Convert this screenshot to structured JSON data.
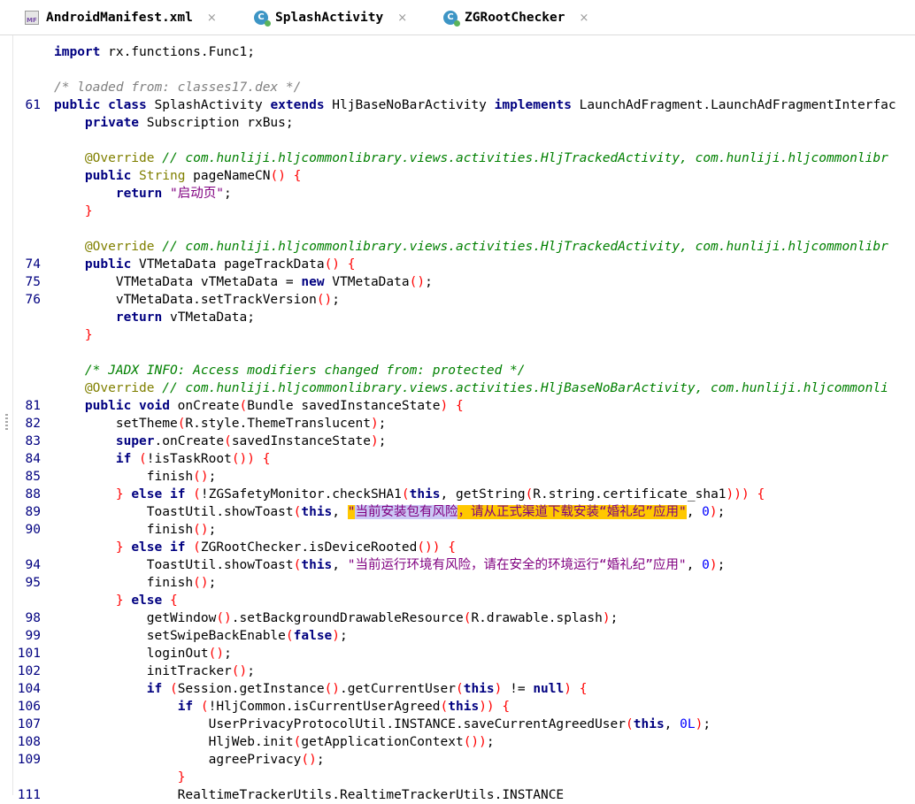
{
  "tabs": [
    {
      "label": "AndroidManifest.xml",
      "icon": "manifest-file-icon",
      "close": "×"
    },
    {
      "label": "SplashActivity",
      "icon": "class-file-icon",
      "close": "×"
    },
    {
      "label": "ZGRootChecker",
      "icon": "class-file-icon",
      "close": "×"
    }
  ],
  "editor": {
    "lines": [
      {
        "n": "",
        "t": [
          [
            "",
            ""
          ]
        ]
      },
      {
        "n": "",
        "t": [
          [
            "kw",
            "import"
          ],
          [
            "",
            " rx.functions.Func1;"
          ]
        ]
      },
      {
        "n": "",
        "t": [
          [
            "",
            ""
          ]
        ]
      },
      {
        "n": "",
        "t": [
          [
            "cm",
            "/* loaded from: classes17.dex */"
          ]
        ]
      },
      {
        "n": "61",
        "t": [
          [
            "kw",
            "public class"
          ],
          [
            "",
            " SplashActivity "
          ],
          [
            "kw",
            "extends"
          ],
          [
            "",
            " HljBaseNoBarActivity "
          ],
          [
            "kw",
            "implements"
          ],
          [
            "",
            " LaunchAdFragment.LaunchAdFragmentInterfac"
          ]
        ]
      },
      {
        "n": "",
        "t": [
          [
            "",
            "    "
          ],
          [
            "kw",
            "private"
          ],
          [
            "",
            " Subscription rxBus;"
          ]
        ]
      },
      {
        "n": "",
        "t": [
          [
            "",
            ""
          ]
        ]
      },
      {
        "n": "",
        "t": [
          [
            "",
            "    "
          ],
          [
            "ann",
            "@Override"
          ],
          [
            "",
            " "
          ],
          [
            "cmg",
            "// com.hunliji.hljcommonlibrary.views.activities.HljTrackedActivity, com.hunliji.hljcommonlibr"
          ]
        ]
      },
      {
        "n": "",
        "t": [
          [
            "",
            "    "
          ],
          [
            "kw",
            "public"
          ],
          [
            "",
            " "
          ],
          [
            "typ",
            "String"
          ],
          [
            "",
            " pageNameCN"
          ],
          [
            "par",
            "()"
          ],
          [
            "",
            " "
          ],
          [
            "par",
            "{"
          ]
        ]
      },
      {
        "n": "",
        "t": [
          [
            "",
            "        "
          ],
          [
            "kw",
            "return"
          ],
          [
            "",
            " "
          ],
          [
            "strp",
            "\"启动页\""
          ],
          [
            "",
            ";"
          ]
        ]
      },
      {
        "n": "",
        "t": [
          [
            "",
            "    "
          ],
          [
            "par",
            "}"
          ]
        ]
      },
      {
        "n": "",
        "t": [
          [
            "",
            ""
          ]
        ]
      },
      {
        "n": "",
        "t": [
          [
            "",
            "    "
          ],
          [
            "ann",
            "@Override"
          ],
          [
            "",
            " "
          ],
          [
            "cmg",
            "// com.hunliji.hljcommonlibrary.views.activities.HljTrackedActivity, com.hunliji.hljcommonlibr"
          ]
        ]
      },
      {
        "n": "74",
        "t": [
          [
            "",
            "    "
          ],
          [
            "kw",
            "public"
          ],
          [
            "",
            " VTMetaData pageTrackData"
          ],
          [
            "par",
            "()"
          ],
          [
            "",
            " "
          ],
          [
            "par",
            "{"
          ]
        ]
      },
      {
        "n": "75",
        "t": [
          [
            "",
            "        VTMetaData vTMetaData = "
          ],
          [
            "kw",
            "new"
          ],
          [
            "",
            " VTMetaData"
          ],
          [
            "par",
            "()"
          ],
          [
            "",
            ";"
          ]
        ]
      },
      {
        "n": "76",
        "t": [
          [
            "",
            "        vTMetaData.setTrackVersion"
          ],
          [
            "par",
            "()"
          ],
          [
            "",
            ";"
          ]
        ]
      },
      {
        "n": "",
        "t": [
          [
            "",
            "        "
          ],
          [
            "kw",
            "return"
          ],
          [
            "",
            " vTMetaData;"
          ]
        ]
      },
      {
        "n": "",
        "t": [
          [
            "",
            "    "
          ],
          [
            "par",
            "}"
          ]
        ]
      },
      {
        "n": "",
        "t": [
          [
            "",
            ""
          ]
        ]
      },
      {
        "n": "",
        "t": [
          [
            "",
            "    "
          ],
          [
            "cmg",
            "/* JADX INFO: Access modifiers changed from: protected */"
          ]
        ]
      },
      {
        "n": "",
        "t": [
          [
            "",
            "    "
          ],
          [
            "ann",
            "@Override"
          ],
          [
            "",
            " "
          ],
          [
            "cmg",
            "// com.hunliji.hljcommonlibrary.views.activities.HljBaseNoBarActivity, com.hunliji.hljcommonli"
          ]
        ]
      },
      {
        "n": "81",
        "t": [
          [
            "",
            "    "
          ],
          [
            "kw",
            "public void"
          ],
          [
            "",
            " onCreate"
          ],
          [
            "par",
            "("
          ],
          [
            "",
            "Bundle savedInstanceState"
          ],
          [
            "par",
            ")"
          ],
          [
            "",
            " "
          ],
          [
            "par",
            "{"
          ]
        ]
      },
      {
        "n": "82",
        "t": [
          [
            "",
            "        setTheme"
          ],
          [
            "par",
            "("
          ],
          [
            "",
            "R.style.ThemeTranslucent"
          ],
          [
            "par",
            ")"
          ],
          [
            "",
            ";"
          ]
        ]
      },
      {
        "n": "83",
        "t": [
          [
            "",
            "        "
          ],
          [
            "kw",
            "super"
          ],
          [
            "",
            ".onCreate"
          ],
          [
            "par",
            "("
          ],
          [
            "",
            "savedInstanceState"
          ],
          [
            "par",
            ")"
          ],
          [
            "",
            ";"
          ]
        ]
      },
      {
        "n": "84",
        "t": [
          [
            "",
            "        "
          ],
          [
            "kw",
            "if"
          ],
          [
            "",
            " "
          ],
          [
            "par",
            "("
          ],
          [
            "",
            "!isTaskRoot"
          ],
          [
            "par",
            "())"
          ],
          [
            "",
            " "
          ],
          [
            "par",
            "{"
          ]
        ]
      },
      {
        "n": "85",
        "t": [
          [
            "",
            "            finish"
          ],
          [
            "par",
            "()"
          ],
          [
            "",
            ";"
          ]
        ]
      },
      {
        "n": "88",
        "t": [
          [
            "",
            "        "
          ],
          [
            "par",
            "}"
          ],
          [
            "",
            " "
          ],
          [
            "kw",
            "else if"
          ],
          [
            "",
            " "
          ],
          [
            "par",
            "("
          ],
          [
            "",
            "!ZGSafetyMonitor.checkSHA1"
          ],
          [
            "par",
            "("
          ],
          [
            "kw",
            "this"
          ],
          [
            "",
            ", getString"
          ],
          [
            "par",
            "("
          ],
          [
            "",
            "R.string.certificate_sha1"
          ],
          [
            "par",
            ")))"
          ],
          [
            "",
            " "
          ],
          [
            "par",
            "{"
          ]
        ]
      },
      {
        "n": "89",
        "t": [
          [
            "",
            "            ToastUtil.showToast"
          ],
          [
            "par",
            "("
          ],
          [
            "kw",
            "this"
          ],
          [
            "",
            ", "
          ],
          [
            "strp hl2",
            "\""
          ],
          [
            "strp hl1",
            "当前安装包有风险"
          ],
          [
            "strp hl2",
            "，请从正式渠道下载安装“婚礼纪”应用\""
          ],
          [
            "",
            ", "
          ],
          [
            "num",
            "0"
          ],
          [
            "par",
            ")"
          ],
          [
            "",
            ";"
          ]
        ]
      },
      {
        "n": "90",
        "t": [
          [
            "",
            "            finish"
          ],
          [
            "par",
            "()"
          ],
          [
            "",
            ";"
          ]
        ]
      },
      {
        "n": "",
        "t": [
          [
            "",
            "        "
          ],
          [
            "par",
            "}"
          ],
          [
            "",
            " "
          ],
          [
            "kw",
            "else if"
          ],
          [
            "",
            " "
          ],
          [
            "par",
            "("
          ],
          [
            "",
            "ZGRootChecker.isDeviceRooted"
          ],
          [
            "par",
            "())"
          ],
          [
            "",
            " "
          ],
          [
            "par",
            "{"
          ]
        ]
      },
      {
        "n": "94",
        "t": [
          [
            "",
            "            ToastUtil.showToast"
          ],
          [
            "par",
            "("
          ],
          [
            "kw",
            "this"
          ],
          [
            "",
            ", "
          ],
          [
            "strp",
            "\"当前运行环境有风险，请在安全的环境运行“婚礼纪”应用\""
          ],
          [
            "",
            ", "
          ],
          [
            "num",
            "0"
          ],
          [
            "par",
            ")"
          ],
          [
            "",
            ";"
          ]
        ]
      },
      {
        "n": "95",
        "t": [
          [
            "",
            "            finish"
          ],
          [
            "par",
            "()"
          ],
          [
            "",
            ";"
          ]
        ]
      },
      {
        "n": "",
        "t": [
          [
            "",
            "        "
          ],
          [
            "par",
            "}"
          ],
          [
            "",
            " "
          ],
          [
            "kw",
            "else"
          ],
          [
            "",
            " "
          ],
          [
            "par",
            "{"
          ]
        ]
      },
      {
        "n": "98",
        "t": [
          [
            "",
            "            getWindow"
          ],
          [
            "par",
            "()"
          ],
          [
            "",
            ".setBackgroundDrawableResource"
          ],
          [
            "par",
            "("
          ],
          [
            "",
            "R.drawable.splash"
          ],
          [
            "par",
            ")"
          ],
          [
            "",
            ";"
          ]
        ]
      },
      {
        "n": "99",
        "t": [
          [
            "",
            "            setSwipeBackEnable"
          ],
          [
            "par",
            "("
          ],
          [
            "kw",
            "false"
          ],
          [
            "par",
            ")"
          ],
          [
            "",
            ";"
          ]
        ]
      },
      {
        "n": "101",
        "t": [
          [
            "",
            "            loginOut"
          ],
          [
            "par",
            "()"
          ],
          [
            "",
            ";"
          ]
        ]
      },
      {
        "n": "102",
        "t": [
          [
            "",
            "            initTracker"
          ],
          [
            "par",
            "()"
          ],
          [
            "",
            ";"
          ]
        ]
      },
      {
        "n": "104",
        "t": [
          [
            "",
            "            "
          ],
          [
            "kw",
            "if"
          ],
          [
            "",
            " "
          ],
          [
            "par",
            "("
          ],
          [
            "",
            "Session.getInstance"
          ],
          [
            "par",
            "()"
          ],
          [
            "",
            ".getCurrentUser"
          ],
          [
            "par",
            "("
          ],
          [
            "kw",
            "this"
          ],
          [
            "par",
            ")"
          ],
          [
            "",
            " != "
          ],
          [
            "kw",
            "null"
          ],
          [
            "par",
            ")"
          ],
          [
            "",
            " "
          ],
          [
            "par",
            "{"
          ]
        ]
      },
      {
        "n": "106",
        "t": [
          [
            "",
            "                "
          ],
          [
            "kw",
            "if"
          ],
          [
            "",
            " "
          ],
          [
            "par",
            "("
          ],
          [
            "",
            "!HljCommon.isCurrentUserAgreed"
          ],
          [
            "par",
            "("
          ],
          [
            "kw",
            "this"
          ],
          [
            "par",
            "))"
          ],
          [
            "",
            " "
          ],
          [
            "par",
            "{"
          ]
        ]
      },
      {
        "n": "107",
        "t": [
          [
            "",
            "                    UserPrivacyProtocolUtil.INSTANCE.saveCurrentAgreedUser"
          ],
          [
            "par",
            "("
          ],
          [
            "kw",
            "this"
          ],
          [
            "",
            ", "
          ],
          [
            "num",
            "0L"
          ],
          [
            "par",
            ")"
          ],
          [
            "",
            ";"
          ]
        ]
      },
      {
        "n": "108",
        "t": [
          [
            "",
            "                    HljWeb.init"
          ],
          [
            "par",
            "("
          ],
          [
            "",
            "getApplicationContext"
          ],
          [
            "par",
            "())"
          ],
          [
            "",
            ";"
          ]
        ]
      },
      {
        "n": "109",
        "t": [
          [
            "",
            "                    agreePrivacy"
          ],
          [
            "par",
            "()"
          ],
          [
            "",
            ";"
          ]
        ]
      },
      {
        "n": "",
        "t": [
          [
            "",
            "                "
          ],
          [
            "par",
            "}"
          ]
        ]
      },
      {
        "n": "111",
        "t": [
          [
            "",
            "                RealtimeTrackerUtils.RealtimeTrackerUtils.INSTANCE"
          ]
        ]
      }
    ]
  }
}
